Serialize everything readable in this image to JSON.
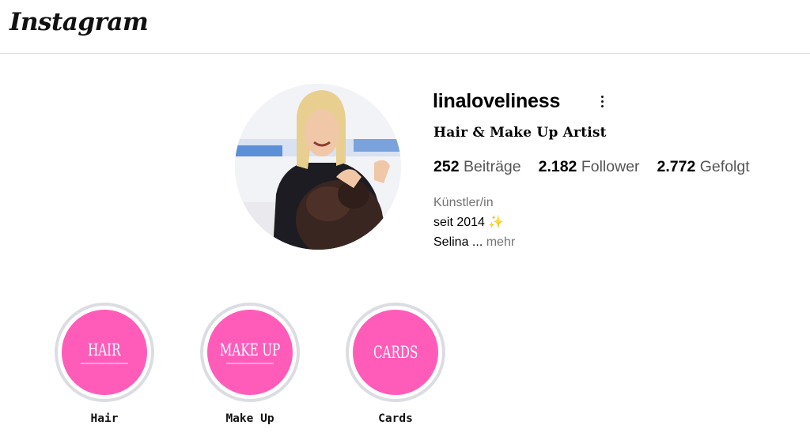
{
  "app": {
    "logo_text": "Instagram"
  },
  "profile": {
    "username": "linaloveliness",
    "full_name": "Hair & Make Up Artist",
    "avatar_icon": "profile-photo",
    "stats": {
      "posts_count": "252",
      "posts_label": "Beiträge",
      "followers_count": "2.182",
      "followers_label": "Follower",
      "following_count": "2.772",
      "following_label": "Gefolgt"
    },
    "bio": {
      "category": "Künstler/in",
      "line1": "seit 2014",
      "line1_emoji": "✨",
      "line2": "Selina ...",
      "more_label": "mehr"
    },
    "options_icon": "more-vertical-icon"
  },
  "highlights": [
    {
      "cover_text": "HAIR",
      "label": "Hair",
      "color": "#ff5cba"
    },
    {
      "cover_text": "MAKE UP",
      "label": "Make Up",
      "color": "#ff5cba"
    },
    {
      "cover_text": "CARDS",
      "label": "Cards",
      "color": "#ff5cba"
    }
  ],
  "colors": {
    "highlight_ring": "#dbdde3",
    "secondary_text": "#737373",
    "divider": "#dbdbdb"
  }
}
